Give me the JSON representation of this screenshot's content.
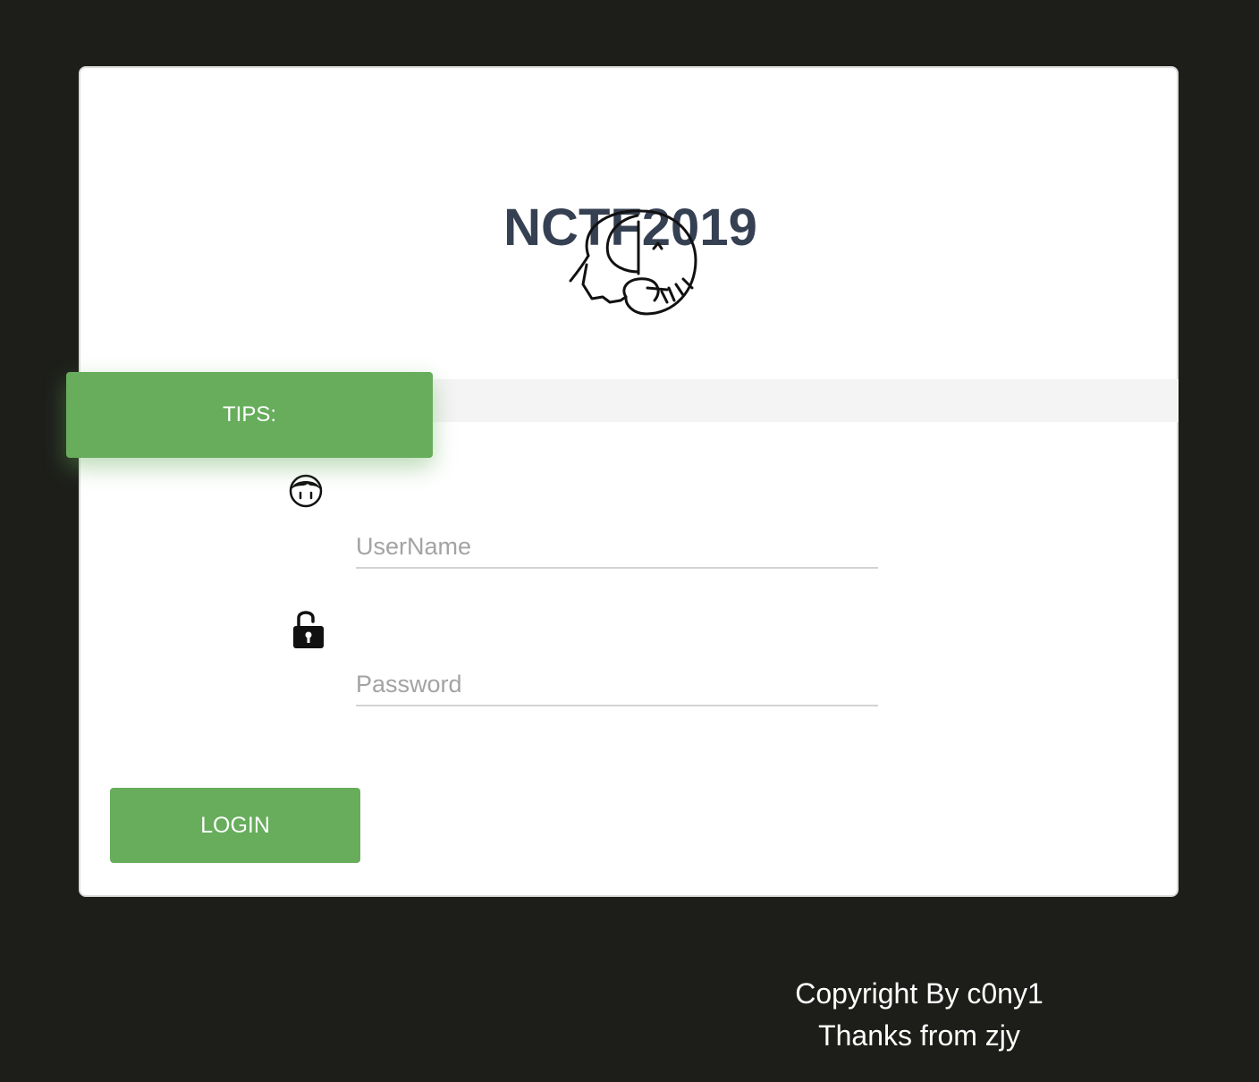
{
  "login_card": {
    "title": "NCTF2019",
    "logo_icon": "elephant-logo",
    "tips_label": "TIPS:",
    "username": {
      "icon": "user-face-icon",
      "placeholder": "UserName",
      "value": ""
    },
    "password": {
      "icon": "unlock-icon",
      "placeholder": "Password",
      "value": ""
    },
    "login_label": "LOGIN"
  },
  "footer": {
    "copyright": "Copyright By c0ny1",
    "thanks": "Thanks from zjy"
  },
  "colors": {
    "background": "#1d1e1a",
    "accent": "#67ad5c",
    "title": "#354052"
  }
}
